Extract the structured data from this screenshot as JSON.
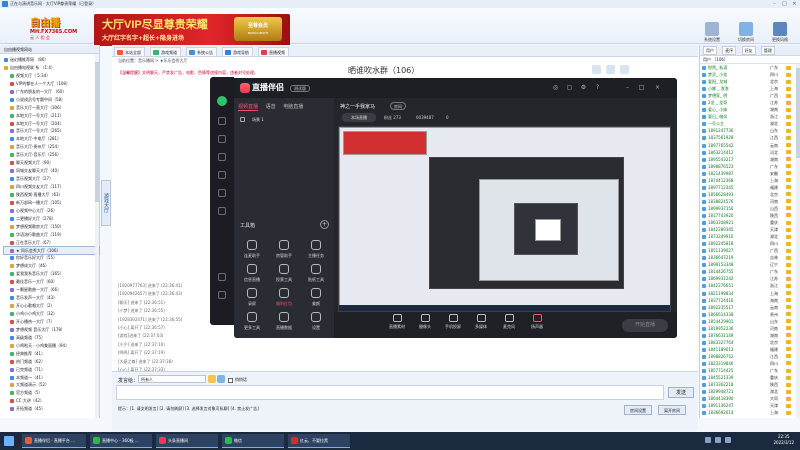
{
  "window": {
    "title": "正在与演讲音乐网 · 大厅VIP尊贵荣耀（已登录）"
  },
  "banner": {
    "logo_main": "自由播",
    "logo_url": "MH.FX7365.COM",
    "logo_slogan": "云 人 相 会",
    "vip_title": "大厅VIP尽显尊贵荣耀",
    "vip_sub": "大厅红字名字+超长+隐身进场",
    "badge_top": "至尊会员",
    "badge_bottom": "MMOCOMSFH"
  },
  "toolbar": {
    "items": [
      {
        "label": "系统设置"
      },
      {
        "label": "切换房间"
      },
      {
        "label": "更换风格"
      }
    ]
  },
  "left_panel": {
    "header": "自由播视频网站",
    "tree": [
      {
        "label": "迷幻播推荐网 （86）"
      },
      {
        "label": "自由播电视联 系 （1:4）"
      },
      {
        "label": "视频大厅（ 5:34）"
      },
      {
        "label": "VIP的都在人一个大厅（108）"
      },
      {
        "label": "广东的朋友的一大厅 （60）"
      },
      {
        "label": "小说成员号专题中间（58）"
      },
      {
        "label": "音乐大厅一直大厅（306）"
      },
      {
        "label": "本地大厅一号大厅（211）"
      },
      {
        "label": "本地大厅一号大厅（204）"
      },
      {
        "label": "音乐大厅一号大厅（265）"
      },
      {
        "label": "本地大厅-中电厅（281）"
      },
      {
        "label": "音乐大厅-贵州厅（254）"
      },
      {
        "label": "音乐大厅-音乐厅（256）"
      },
      {
        "label": "聊天视频大厅（90）"
      },
      {
        "label": "同城交友聊天大厅（40）"
      },
      {
        "label": "音乐视频大厅（27）"
      },
      {
        "label": "四川视频交友大厅（117）"
      },
      {
        "label": "陕西视频-直播大厅（63）"
      },
      {
        "label": "新万部网一播大厅（105）"
      },
      {
        "label": "心视频中心大厅（26）"
      },
      {
        "label": "二更播好大厅（278）"
      },
      {
        "label": "梦想视频歌房大厅（150）"
      },
      {
        "label": "华语流行歌曲大厅（119）"
      },
      {
        "label": "正在音乐大厅（67）"
      },
      {
        "label": "★ 同乐会秀大厅（106）"
      },
      {
        "label": "你好音乐好大厅（55）"
      },
      {
        "label": "梦想成大厅（46）"
      },
      {
        "label": "爱我我系音乐大厅（165）"
      },
      {
        "label": "最佳音乐一大厅（60）"
      },
      {
        "label": "一颗星歌曲一大厅（66）"
      },
      {
        "label": "音乐发声一大厅（43）"
      },
      {
        "label": "开心心歌唱大厅（2）"
      },
      {
        "label": "小鸡小小鸡大厅（32）"
      },
      {
        "label": "开心播热一大厅（7）"
      },
      {
        "label": "梦想视频 音乐大厅（178）"
      },
      {
        "label": "高级频道（75）"
      },
      {
        "label": "小鸡啦天 - 小鸡美丽播（94）"
      },
      {
        "label": "经典推荐（41）"
      },
      {
        "label": "热门频道（62）"
      },
      {
        "label": "已完频道（71）"
      },
      {
        "label": "本频道一（41）"
      },
      {
        "label": "大频道演示（52）"
      },
      {
        "label": "官方频道（5）"
      },
      {
        "label": "CC 大讲（42）"
      },
      {
        "label": "开拓频道（45）"
      }
    ],
    "selected_index": 24
  },
  "dict_tab": "游戏大厅",
  "center": {
    "tabs": [
      {
        "label": "本站全部"
      },
      {
        "label": "游戏频道"
      },
      {
        "label": "系统公告"
      },
      {
        "label": "游戏导航"
      },
      {
        "label": "直播视频"
      }
    ],
    "path": "当前位置：音乐播网 > ★乐乐会秀大厅",
    "notice": "【温馨提醒】文明聊天，严禁发广告，电影、色情等违规内容，违者封号处理。",
    "messages": [
      {
        "text": "[1920977763] 进来了 (22:36:41)"
      },
      {
        "text": "[1920942657] 进来了 (22:36:43)"
      },
      {
        "text": "[聊天] 进来了 (22:36:51)"
      },
      {
        "text": "[小梦] 进来了 (22:36:55)"
      },
      {
        "text": "[1928392471] 进来了 (22:36:55)"
      },
      {
        "text": "[小心] 离开了 (22:36:57)"
      },
      {
        "text": "[游戏]进来了 (22:37:03)"
      },
      {
        "text": "[小宁] 进来了 (22:37:10)"
      },
      {
        "text": "[鸣鸣] 离开了 (22:37:19)"
      },
      {
        "text": "[大豪之尊] 进来了 (22:37:28)"
      },
      {
        "text": "[心心] 离开了 (22:37:33)"
      }
    ],
    "chat_title": "晒谁吹水群（106）",
    "say_label": "发言给：",
    "say_target": "所有人",
    "anon_label": "悄悄话",
    "send_label": "发送",
    "tips": "提示：[1. 请文明发言]   [2. 请勿刷屏]   [3. 选择发言对象可私聊]   [4. 禁止发广告]",
    "btn_bottom1": "房间设置",
    "btn_bottom2": "离开房间"
  },
  "right_panel": {
    "tabs": [
      {
        "label": "用户"
      },
      {
        "label": "麦序"
      },
      {
        "label": "好友"
      },
      {
        "label": "管理"
      }
    ],
    "header": "用户 （106）",
    "users": [
      {
        "name": "悦然_ 私语",
        "loc": "广东"
      },
      {
        "name": "梦灵_ 小花",
        "loc": "四川"
      },
      {
        "name": "爱阳_ 龙城",
        "loc": "北京"
      },
      {
        "name": "小娜 _ 泡泡",
        "loc": "上海"
      },
      {
        "name": "梦想家_ 明",
        "loc": "广西"
      },
      {
        "name": "2龙 _ 龙哥",
        "loc": "江苏"
      },
      {
        "name": "爱心_ 小妹",
        "loc": "湖南"
      },
      {
        "name": "夏日_ 微风",
        "loc": "浙江"
      },
      {
        "name": "一号公主",
        "loc": "湖北"
      },
      {
        "name": "1891247736",
        "loc": "山东"
      },
      {
        "name": "1837561928",
        "loc": "江西"
      },
      {
        "name": "1897765542",
        "loc": "云南"
      },
      {
        "name": "1863214412",
        "loc": "河北"
      },
      {
        "name": "1895543217",
        "loc": "湖南"
      },
      {
        "name": "1898876523",
        "loc": "广东"
      },
      {
        "name": "1821439987",
        "loc": "安徽"
      },
      {
        "name": "1874412368",
        "loc": "上海"
      },
      {
        "name": "1897712345",
        "loc": "福建"
      },
      {
        "name": "1856628493",
        "loc": "北京"
      },
      {
        "name": "1838824576",
        "loc": "河南"
      },
      {
        "name": "1899937156",
        "loc": "山西"
      },
      {
        "name": "1817743920",
        "loc": "陕西"
      },
      {
        "name": "1863348921",
        "loc": "重庆"
      },
      {
        "name": "1842289345",
        "loc": "天津"
      },
      {
        "name": "1873349910",
        "loc": "湖北"
      },
      {
        "name": "1892245818",
        "loc": "四川"
      },
      {
        "name": "1851139027",
        "loc": "广西"
      },
      {
        "name": "1836647219",
        "loc": "吉林"
      },
      {
        "name": "1899153348",
        "loc": "辽宁"
      },
      {
        "name": "1814426755",
        "loc": "广东"
      },
      {
        "name": "1869931242",
        "loc": "江苏"
      },
      {
        "name": "1842276651",
        "loc": "浙江"
      },
      {
        "name": "1821198834",
        "loc": "上海"
      },
      {
        "name": "1837724416",
        "loc": "海南"
      },
      {
        "name": "1892235517",
        "loc": "云南"
      },
      {
        "name": "1866614338",
        "loc": "贵州"
      },
      {
        "name": "1854429901",
        "loc": "山东"
      },
      {
        "name": "1819952236",
        "loc": "河南"
      },
      {
        "name": "1876631149",
        "loc": "湖南"
      },
      {
        "name": "1883327764",
        "loc": "北京"
      },
      {
        "name": "1841189013",
        "loc": "福建"
      },
      {
        "name": "1898826752",
        "loc": "江西"
      },
      {
        "name": "1823319846",
        "loc": "四川"
      },
      {
        "name": "1857714425",
        "loc": "广东"
      },
      {
        "name": "1845521339",
        "loc": "重庆"
      },
      {
        "name": "1873362218",
        "loc": "陕西"
      },
      {
        "name": "1829948721",
        "loc": "湖北"
      },
      {
        "name": "1864418390",
        "loc": "大同"
      },
      {
        "name": "1891136247",
        "loc": "天津"
      },
      {
        "name": "1836692614",
        "loc": "上海"
      }
    ]
  },
  "zbj": {
    "logo": "直播伴侣",
    "version": "测试版",
    "tabs": [
      {
        "label": "视频直播"
      },
      {
        "label": "语音"
      },
      {
        "label": "电脑直播"
      }
    ],
    "scene": "场景 1",
    "room_name": "神之一手我家马",
    "room_tag": "房间",
    "clear_label": "本场直播",
    "stat1": "粉丝 273",
    "stat2": "0039487",
    "stat3": "0",
    "tool_title": "工具箱",
    "tools": [
      {
        "label": "连麦助手"
      },
      {
        "label": "房管助手"
      },
      {
        "label": "主播任务"
      },
      {
        "label": "信息直播"
      },
      {
        "label": "投票工具"
      },
      {
        "label": "贴纸工具"
      },
      {
        "label": "录屏"
      },
      {
        "label": "福利红包"
      },
      {
        "label": "美颜"
      },
      {
        "label": "更多工具"
      },
      {
        "label": "直播数据"
      },
      {
        "label": "设置"
      }
    ],
    "controls": [
      {
        "label": "直播素材"
      },
      {
        "label": "摄像头"
      },
      {
        "label": "手机投屏"
      },
      {
        "label": "多媒体"
      },
      {
        "label": "麦克风"
      },
      {
        "label": "扬声器"
      }
    ],
    "go_live": "开始直播"
  },
  "taskbar": {
    "items": [
      {
        "label": "直播伴侣 · 直播平台 ..."
      },
      {
        "label": "直播中心 - 360极 ..."
      },
      {
        "label": "头条直播间"
      },
      {
        "label": "微信"
      },
      {
        "label": "红云、不要拉黑"
      }
    ],
    "time": "22:35",
    "date": "2022/3/12"
  },
  "colors": {
    "accent": "#2d86d8",
    "vip_red": "#e0262a",
    "zbj_pink": "#ff4c6a",
    "user_green": "#0a7a1a"
  }
}
